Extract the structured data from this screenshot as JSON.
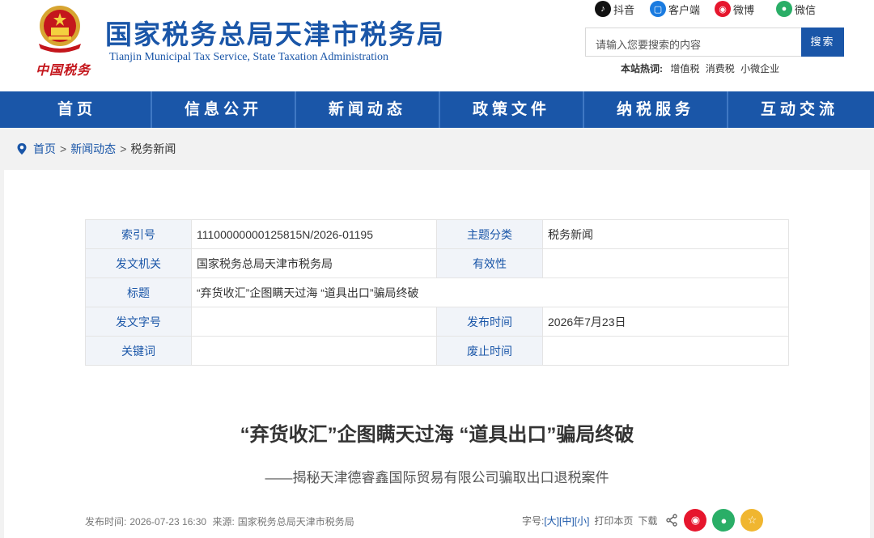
{
  "header": {
    "title": "国家税务总局天津市税务局",
    "subtitle": "Tianjin Municipal Tax Service, State Taxation Administration",
    "emblem_text": "中国税务",
    "social": [
      {
        "label": "抖音",
        "icon": "douyin-icon",
        "color": "#111111"
      },
      {
        "label": "客户端",
        "icon": "app-icon",
        "color": "#1a7be0"
      },
      {
        "label": "微博",
        "icon": "weibo-icon",
        "color": "#e6162d"
      },
      {
        "label": "微信",
        "icon": "wechat-icon",
        "color": "#2aae67"
      }
    ],
    "search": {
      "placeholder": "请输入您要搜索的内容",
      "button": "搜索"
    },
    "hot": {
      "label": "本站热词:",
      "words": [
        "增值税",
        "消费税",
        "小微企业"
      ]
    }
  },
  "nav": [
    "首页",
    "信息公开",
    "新闻动态",
    "政策文件",
    "纳税服务",
    "互动交流"
  ],
  "breadcrumb": {
    "home": "首页",
    "section": "新闻动态",
    "current": "税务新闻",
    "sep": ">"
  },
  "meta": {
    "index_label": "索引号",
    "index_value": "11100000000125815N/2026-01195",
    "topic_label": "主题分类",
    "topic_value": "税务新闻",
    "issuer_label": "发文机关",
    "issuer_value": "国家税务总局天津市税务局",
    "validity_label": "有效性",
    "validity_value": "",
    "title_label": "标题",
    "title_value": "“弃货收汇”企图瞒天过海 “道具出口”骗局终破",
    "docno_label": "发文字号",
    "docno_value": "",
    "pubtime_label": "发布时间",
    "pubtime_value": "2026年7月23日",
    "keywords_label": "关键词",
    "keywords_value": "",
    "abolish_label": "废止时间",
    "abolish_value": ""
  },
  "article": {
    "title": "“弃货收汇”企图瞒天过海 “道具出口”骗局终破",
    "subtitle": "——揭秘天津德睿鑫国际贸易有限公司骗取出口退税案件",
    "pub_label": "发布时间:",
    "pub_time": "2026-07-23 16:30",
    "source_label": "来源:",
    "source": "国家税务总局天津市税务局"
  },
  "tools": {
    "font_label": "字号:",
    "font_large": "[大]",
    "font_medium": "[中]",
    "font_small": "[小]",
    "print": "打印本页",
    "download": "下载"
  },
  "colors": {
    "primary": "#1a56a8",
    "label_bg": "#f1f4f9",
    "weibo": "#e6162d",
    "wechat": "#2aae67",
    "favorite": "#f0b630"
  }
}
